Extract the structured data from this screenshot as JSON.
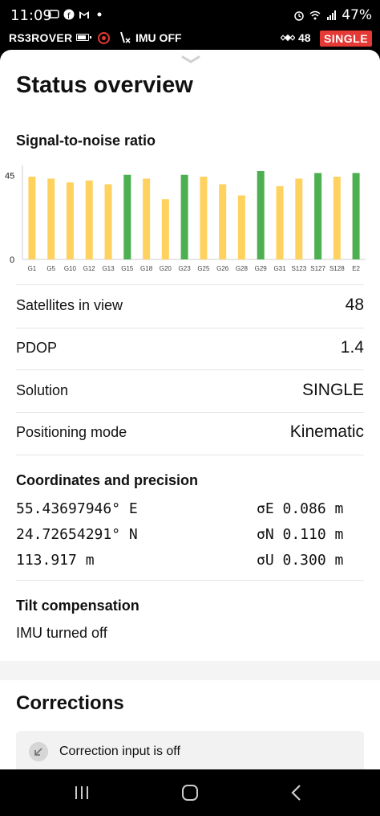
{
  "statusbar": {
    "time": "11:09",
    "battery_pct": "47%",
    "icons_left": [
      "message-icon",
      "facebook-icon",
      "gmail-icon",
      "dot-icon"
    ],
    "icons_right": [
      "alarm-icon",
      "vibrate-icon",
      "wifi-icon",
      "volte-icon",
      "signal-icon"
    ]
  },
  "rover": {
    "name": "RS3ROVER",
    "imu": "IMU OFF",
    "sat_count": "48",
    "solution_badge": "SINGLE",
    "badge_color": "#e53935"
  },
  "status": {
    "title": "Status overview",
    "snr_title": "Signal-to-noise ratio",
    "rows": [
      {
        "label": "Satellites in view",
        "value": "48"
      },
      {
        "label": "PDOP",
        "value": "1.4"
      },
      {
        "label": "Solution",
        "value": "SINGLE"
      },
      {
        "label": "Positioning mode",
        "value": "Kinematic"
      }
    ],
    "coords_title": "Coordinates and precision",
    "coords": [
      {
        "value": "55.43697946° E",
        "precision": "σE 0.086 m"
      },
      {
        "value": "24.72654291° N",
        "precision": "σN 0.110 m"
      },
      {
        "value": "113.917 m",
        "precision": "σU 0.300 m"
      }
    ],
    "tilt_title": "Tilt compensation",
    "tilt_value": "IMU turned off"
  },
  "corrections": {
    "title": "Corrections",
    "message": "Correction input is off"
  },
  "chart_data": {
    "type": "bar",
    "title": "Signal-to-noise ratio",
    "categories": [
      "G1",
      "G5",
      "G10",
      "G12",
      "G13",
      "G15",
      "G18",
      "G20",
      "G23",
      "G25",
      "G26",
      "G28",
      "G29",
      "G31",
      "S123",
      "S127",
      "S128",
      "E2"
    ],
    "values": [
      44,
      43,
      41,
      42,
      40,
      45,
      43,
      32,
      45,
      44,
      40,
      34,
      47,
      39,
      43,
      46,
      44,
      46
    ],
    "status": [
      "weak",
      "weak",
      "weak",
      "weak",
      "weak",
      "strong",
      "weak",
      "weak",
      "strong",
      "weak",
      "weak",
      "weak",
      "strong",
      "weak",
      "weak",
      "strong",
      "weak",
      "strong"
    ],
    "colors": {
      "weak": "#ffd260",
      "strong": "#4caf50"
    },
    "yticks": [
      "45",
      "0"
    ],
    "ylim": [
      0,
      50
    ],
    "grid": false
  }
}
